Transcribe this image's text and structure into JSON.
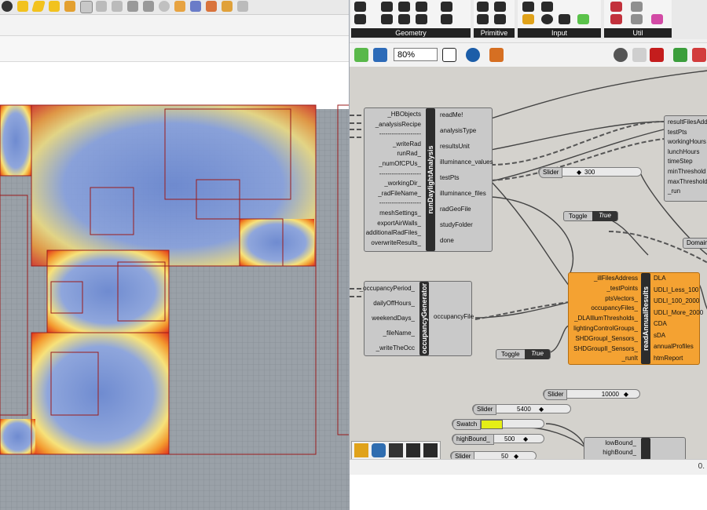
{
  "rhino": {
    "viewport_name": "Rhino viewport - daylight heatmap"
  },
  "gh": {
    "tab_groups": [
      {
        "label": "Geometry"
      },
      {
        "label": "Primitive"
      },
      {
        "label": "Input"
      },
      {
        "label": "Util"
      }
    ],
    "zoom": "80%",
    "run_daylight": {
      "name": "runDaylightAnalysis",
      "inputs": [
        "_HBObjects",
        "_analysisRecipe",
        "--------------------",
        "_writeRad",
        "runRad_",
        "_numOfCPUs_",
        "--------------------",
        "_workingDir_",
        "_radFileName_",
        "--------------------",
        "meshSettings_",
        "exportAirWalls_",
        "additionalRadFiles_",
        "overwriteResults_"
      ],
      "outputs": [
        "readMe!",
        "analysisType",
        "resultsUnit",
        "illuminance_values",
        "testPts",
        "illuminance_files",
        "radGeoFile",
        "studyFolder",
        "done"
      ]
    },
    "occupancy": {
      "name": "occupancyGenerator",
      "inputs": [
        "_occupancyPeriod_",
        "dailyOffHours_",
        "weekendDays_",
        "_fileName_",
        "_writeTheOcc"
      ],
      "outputs": [
        "occupancyFile"
      ]
    },
    "read_annual": {
      "name": "readAnnualResults",
      "inputs": [
        "_illFilesAddress",
        "_testPoints",
        "ptsVectors_",
        "occupancyFiles_",
        "_DLAIllumThresholds_",
        "lightingControlGroups_",
        "SHDGroupI_Sensors_",
        "SHDGroupII_Sensors_",
        "_runIt"
      ],
      "outputs": [
        "DLA",
        "UDLI_Less_100",
        "UDLI_100_2000",
        "UDLI_More_2000",
        "CDA",
        "sDA",
        "annualProfiles",
        "htmReport"
      ]
    },
    "right_comp": {
      "inputs": [
        "resultFilesAddress",
        "testPts",
        "workingHours",
        "lunchHours",
        "timeStep",
        "minThreshold",
        "maxThreshold",
        "_run"
      ]
    },
    "domain_label": "Domain",
    "low_comp_inputs": [
      "lowBound_",
      "highBound_"
    ],
    "sliders": [
      {
        "label": "Slider",
        "value": "300"
      },
      {
        "label": "Slider",
        "value": "10000"
      },
      {
        "label": "Slider",
        "value": "5400"
      },
      {
        "label": "highBound_",
        "value": "500"
      },
      {
        "label": "Slider",
        "value": "50"
      }
    ],
    "toggles": [
      {
        "label": "Toggle",
        "value": "True"
      },
      {
        "label": "Toggle",
        "value": "True"
      }
    ],
    "swatch_label": "Swatch",
    "status_right": "0."
  }
}
